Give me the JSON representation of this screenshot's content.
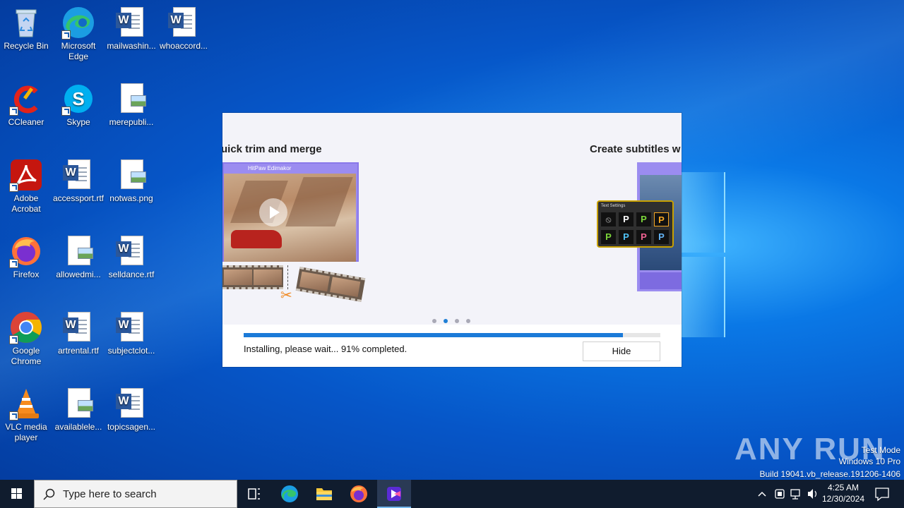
{
  "desktop": {
    "icons": [
      {
        "label": "Recycle Bin"
      },
      {
        "label": "Microsoft Edge"
      },
      {
        "label": "mailwashin..."
      },
      {
        "label": "whoaccord..."
      },
      {
        "label": "CCleaner"
      },
      {
        "label": "Skype"
      },
      {
        "label": "merepubli..."
      },
      {
        "label": "Adobe Acrobat"
      },
      {
        "label": "accessport.rtf"
      },
      {
        "label": "notwas.png"
      },
      {
        "label": "Firefox"
      },
      {
        "label": "allowedmi..."
      },
      {
        "label": "selldance.rtf"
      },
      {
        "label": "Google Chrome"
      },
      {
        "label": "artrental.rtf"
      },
      {
        "label": "subjectclot..."
      },
      {
        "label": "VLC media player"
      },
      {
        "label": "availablele..."
      },
      {
        "label": "topicsagen..."
      }
    ]
  },
  "installer": {
    "slide_left_title": "uick trim and merge",
    "slide_right_title": "Create subtitles w",
    "editor_header": "HitPaw Edimakor",
    "text_settings_title": "Text Settings",
    "text_style_glyphs": [
      "⦸",
      "P",
      "P",
      "P",
      "P",
      "P",
      "P",
      "P"
    ],
    "dots_count": 4,
    "active_dot": 1,
    "progress_percent": 91,
    "status": "Installing, please wait... 91% completed.",
    "hide_label": "Hide",
    "colors": {
      "progress": "#1b7ad8",
      "accent_purple": "#9b8cf0"
    }
  },
  "watermark": {
    "brand": "ANY RUN",
    "line1": "Test Mode",
    "line2": "Windows 10 Pro",
    "line3": "Build 19041.vb_release.191206-1406"
  },
  "taskbar": {
    "search_placeholder": "Type here to search",
    "pinned": [
      "task-view",
      "edge",
      "file-explorer",
      "firefox",
      "edimakor-installer"
    ],
    "time": "4:25 AM",
    "date": "12/30/2024"
  }
}
